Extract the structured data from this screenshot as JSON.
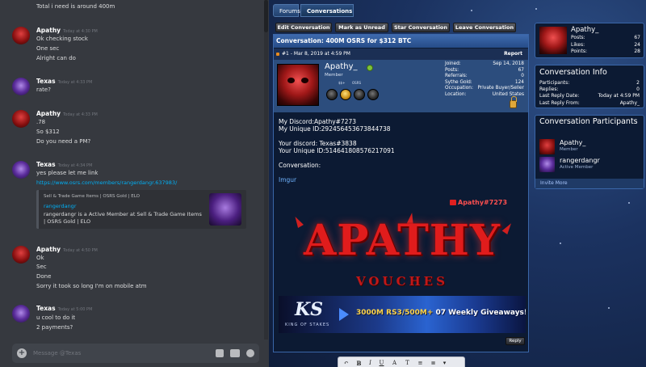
{
  "discord": {
    "messages": [
      {
        "lines": [
          "Total i need is around 400m"
        ]
      },
      {
        "author": "Apathy",
        "time": "Today at 4:30 PM",
        "lines": [
          "Ok checking stock",
          "One sec",
          "Alright can do"
        ]
      },
      {
        "author": "Texas",
        "time": "Today at 4:33 PM",
        "lines": [
          "rate?"
        ]
      },
      {
        "author": "Apathy",
        "time": "Today at 4:33 PM",
        "lines": [
          ".78",
          "So $312",
          "Do you need a PM?"
        ]
      },
      {
        "author": "Texas",
        "time": "Today at 4:34 PM",
        "lines": [
          "yes please let me link"
        ],
        "link": "https://www.osrs.com/members/rangerdangr.637983/",
        "embed": {
          "site": "Sell & Trade Game Items | OSRS Gold | ELO",
          "title": "rangerdangr",
          "desc": "rangerdangr is a Active Member at Sell & Trade Game Items | OSRS Gold | ELO"
        }
      },
      {
        "author": "Apathy",
        "time": "Today at 4:50 PM",
        "lines": [
          "Ok",
          "Sec",
          "Done",
          "Sorry it took so long I'm on mobile atm"
        ]
      },
      {
        "author": "Texas",
        "time": "Today at 5:00 PM",
        "lines": [
          "u cool to do it",
          "2 payments?"
        ]
      }
    ],
    "composer_placeholder": "Message @Texas"
  },
  "forum": {
    "breadcrumb": [
      "Forums",
      "Conversations"
    ],
    "actions": [
      "Edit Conversation",
      "Mark as Unread",
      "Star Conversation",
      "Leave Conversation"
    ],
    "thread_title": "Conversation: 400M OSRS for $312 BTC",
    "post": {
      "number_date": "#1 - Mar 8, 2019 at 4:59 PM",
      "report": "Report",
      "username": "Apathy_",
      "rank": "Member",
      "badge_labels": [
        "$$+",
        "OSRS"
      ],
      "stats": [
        {
          "k": "Joined:",
          "v": "Sep 14, 2018"
        },
        {
          "k": "Posts:",
          "v": "67"
        },
        {
          "k": "Referrals:",
          "v": "0"
        },
        {
          "k": "Sythe Gold:",
          "v": "124"
        },
        {
          "k": "Occupation:",
          "v": "Private Buyer/Seller"
        },
        {
          "k": "Location:",
          "v": "United States"
        }
      ],
      "body": [
        "My Discord:Apathy#7273",
        "My Unique ID:292456453673844738",
        "",
        "Your discord: Texas#3838",
        "Your Unique ID:514641808576217091",
        "",
        "Conversation:",
        "",
        "Imgur"
      ],
      "sig_tag": "Apathy#7273",
      "sig_main": "APATHY",
      "sig_sub": "VOUCHES",
      "ks_logo": "KS",
      "ks_sub": "KING OF STAKES",
      "ks_text_a": "3000M RS3/500M+",
      "ks_text_b": " 07 Weekly Giveaways!",
      "reply": "Reply"
    },
    "sidebar": {
      "user": {
        "name": "Apathy_",
        "stats": [
          {
            "k": "Posts:",
            "v": "67"
          },
          {
            "k": "Likes:",
            "v": "24"
          },
          {
            "k": "Points:",
            "v": "28"
          }
        ]
      },
      "info": {
        "title": "Conversation Info",
        "stats": [
          {
            "k": "Participants:",
            "v": "2"
          },
          {
            "k": "Replies:",
            "v": "0"
          },
          {
            "k": "Last Reply Date:",
            "v": "Today at 4:59 PM"
          },
          {
            "k": "Last Reply From:",
            "v": "Apathy_"
          }
        ]
      },
      "participants": {
        "title": "Conversation Participants",
        "list": [
          {
            "name": "Apathy_",
            "rank": "Member"
          },
          {
            "name": "rangerdangr",
            "rank": "Active Member"
          }
        ],
        "invite": "Invite More"
      }
    },
    "editor_tools": [
      "↶",
      "B",
      "I",
      "U",
      "A",
      "T",
      "≡",
      "≣",
      "▾"
    ]
  }
}
